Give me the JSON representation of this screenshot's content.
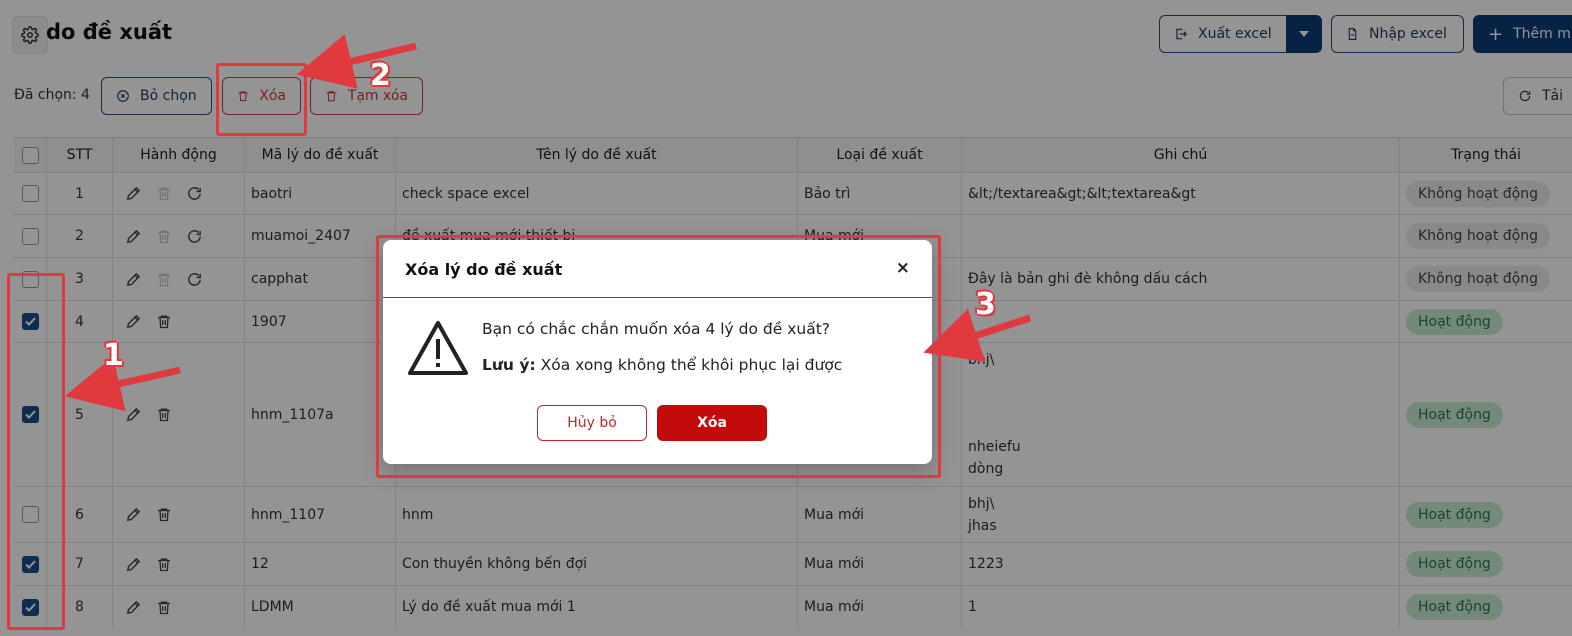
{
  "header": {
    "title": "do đề xuất",
    "export_label": "Xuất excel",
    "import_label": "Nhập excel",
    "add_label": "Thêm m"
  },
  "toolbar": {
    "selected_text": "Đã chọn: 4",
    "deselect_label": "Bỏ chọn",
    "delete_label": "Xóa",
    "temp_delete_label": "Tạm xóa",
    "reload_label": "Tải"
  },
  "table": {
    "columns": [
      "STT",
      "Hành động",
      "Mã lý do đề xuất",
      "Tên lý do đề xuất",
      "Loại đề xuất",
      "Ghi chú",
      "Trạng thái"
    ],
    "rows": [
      {
        "stt": "1",
        "code": "baotri",
        "name": "check space excel",
        "type": "Bảo trì",
        "note": "&lt;/textarea&gt;&lt;textarea&gt",
        "status": "Không hoạt động",
        "checked": false
      },
      {
        "stt": "2",
        "code": "muamoi_2407",
        "name": "đề xuất mua mới thiết bị",
        "type": "Mua mới",
        "note": "",
        "status": "Không hoạt động",
        "checked": false
      },
      {
        "stt": "3",
        "code": "capphat",
        "name": "",
        "type": "",
        "note": "Đây là bản ghi đè không dấu cách",
        "status": "Không hoạt động",
        "checked": false
      },
      {
        "stt": "4",
        "code": "1907",
        "name": "",
        "type": "",
        "note": "",
        "status": "Hoạt động",
        "checked": true
      },
      {
        "stt": "5",
        "code": "hnm_1107a",
        "name": "",
        "type": "",
        "note_lines": [
          "bhj\\",
          "nheiefu",
          "dòng"
        ],
        "status": "Hoạt động",
        "checked": true
      },
      {
        "stt": "6",
        "code": "hnm_1107",
        "name": "hnm",
        "type": "Mua mới",
        "note_lines": [
          "bhj\\",
          "jhas"
        ],
        "status": "Hoạt động",
        "checked": false
      },
      {
        "stt": "7",
        "code": "12",
        "name": "Con thuyền không bến đợi",
        "type": "Mua mới",
        "note": "1223",
        "status": "Hoạt động",
        "checked": true
      },
      {
        "stt": "8",
        "code": "LDMM",
        "name": "Lý do đề xuất mua mới 1",
        "type": "Mua mới",
        "note": "1",
        "status": "Hoạt động",
        "checked": true
      }
    ]
  },
  "modal": {
    "title": "Xóa lý do đề xuất",
    "close": "×",
    "message": "Bạn có chắc chắn muốn xóa 4 lý do đề xuất?",
    "note_label": "Lưu ý:",
    "note_text": "Xóa xong không thể khôi phục lại được",
    "cancel_label": "Hủy bỏ",
    "confirm_label": "Xóa"
  },
  "annotations": [
    "1",
    "2",
    "3"
  ],
  "colors": {
    "primary": "#0b3d78",
    "danger": "#c40b0b",
    "annotation": "#e03a3f",
    "active_pill": "#c7ecd3"
  }
}
